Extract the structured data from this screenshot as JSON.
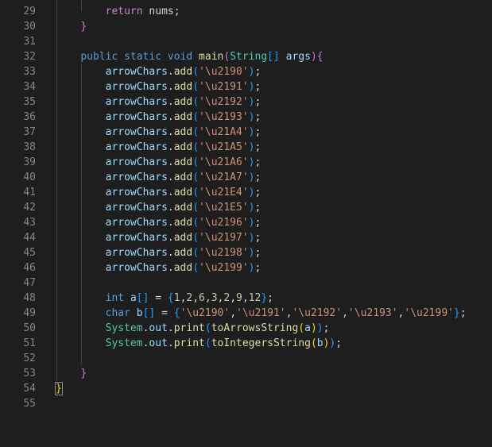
{
  "editor": {
    "lines": [
      {
        "n": "29",
        "tokens": [
          {
            "t": "        ",
            "c": "plain"
          },
          {
            "t": "return",
            "c": "kw-ctrl"
          },
          {
            "t": " nums;",
            "c": "plain"
          }
        ]
      },
      {
        "n": "30",
        "tokens": [
          {
            "t": "    ",
            "c": "plain"
          },
          {
            "t": "}",
            "c": "brace-purple"
          }
        ]
      },
      {
        "n": "31",
        "tokens": []
      },
      {
        "n": "32",
        "tokens": [
          {
            "t": "    ",
            "c": "plain"
          },
          {
            "t": "public",
            "c": "kw"
          },
          {
            "t": " ",
            "c": "plain"
          },
          {
            "t": "static",
            "c": "kw"
          },
          {
            "t": " ",
            "c": "plain"
          },
          {
            "t": "void",
            "c": "kw"
          },
          {
            "t": " ",
            "c": "plain"
          },
          {
            "t": "main",
            "c": "fn"
          },
          {
            "t": "(",
            "c": "brace-purple"
          },
          {
            "t": "String",
            "c": "type"
          },
          {
            "t": "[]",
            "c": "brace-blue"
          },
          {
            "t": " ",
            "c": "plain"
          },
          {
            "t": "args",
            "c": "var"
          },
          {
            "t": ")",
            "c": "brace-purple"
          },
          {
            "t": "{",
            "c": "brace-purple"
          }
        ]
      },
      {
        "n": "33",
        "tokens": [
          {
            "t": "        ",
            "c": "plain"
          },
          {
            "t": "arrowChars",
            "c": "var"
          },
          {
            "t": ".",
            "c": "plain"
          },
          {
            "t": "add",
            "c": "fn"
          },
          {
            "t": "(",
            "c": "brace-blue"
          },
          {
            "t": "'\\u2190'",
            "c": "str"
          },
          {
            "t": ")",
            "c": "brace-blue"
          },
          {
            "t": ";",
            "c": "plain"
          }
        ]
      },
      {
        "n": "34",
        "tokens": [
          {
            "t": "        ",
            "c": "plain"
          },
          {
            "t": "arrowChars",
            "c": "var"
          },
          {
            "t": ".",
            "c": "plain"
          },
          {
            "t": "add",
            "c": "fn"
          },
          {
            "t": "(",
            "c": "brace-blue"
          },
          {
            "t": "'\\u2191'",
            "c": "str"
          },
          {
            "t": ")",
            "c": "brace-blue"
          },
          {
            "t": ";",
            "c": "plain"
          }
        ]
      },
      {
        "n": "35",
        "tokens": [
          {
            "t": "        ",
            "c": "plain"
          },
          {
            "t": "arrowChars",
            "c": "var"
          },
          {
            "t": ".",
            "c": "plain"
          },
          {
            "t": "add",
            "c": "fn"
          },
          {
            "t": "(",
            "c": "brace-blue"
          },
          {
            "t": "'\\u2192'",
            "c": "str"
          },
          {
            "t": ")",
            "c": "brace-blue"
          },
          {
            "t": ";",
            "c": "plain"
          }
        ]
      },
      {
        "n": "36",
        "tokens": [
          {
            "t": "        ",
            "c": "plain"
          },
          {
            "t": "arrowChars",
            "c": "var"
          },
          {
            "t": ".",
            "c": "plain"
          },
          {
            "t": "add",
            "c": "fn"
          },
          {
            "t": "(",
            "c": "brace-blue"
          },
          {
            "t": "'\\u2193'",
            "c": "str"
          },
          {
            "t": ")",
            "c": "brace-blue"
          },
          {
            "t": ";",
            "c": "plain"
          }
        ]
      },
      {
        "n": "37",
        "tokens": [
          {
            "t": "        ",
            "c": "plain"
          },
          {
            "t": "arrowChars",
            "c": "var"
          },
          {
            "t": ".",
            "c": "plain"
          },
          {
            "t": "add",
            "c": "fn"
          },
          {
            "t": "(",
            "c": "brace-blue"
          },
          {
            "t": "'\\u21A4'",
            "c": "str"
          },
          {
            "t": ")",
            "c": "brace-blue"
          },
          {
            "t": ";",
            "c": "plain"
          }
        ]
      },
      {
        "n": "38",
        "tokens": [
          {
            "t": "        ",
            "c": "plain"
          },
          {
            "t": "arrowChars",
            "c": "var"
          },
          {
            "t": ".",
            "c": "plain"
          },
          {
            "t": "add",
            "c": "fn"
          },
          {
            "t": "(",
            "c": "brace-blue"
          },
          {
            "t": "'\\u21A5'",
            "c": "str"
          },
          {
            "t": ")",
            "c": "brace-blue"
          },
          {
            "t": ";",
            "c": "plain"
          }
        ]
      },
      {
        "n": "39",
        "tokens": [
          {
            "t": "        ",
            "c": "plain"
          },
          {
            "t": "arrowChars",
            "c": "var"
          },
          {
            "t": ".",
            "c": "plain"
          },
          {
            "t": "add",
            "c": "fn"
          },
          {
            "t": "(",
            "c": "brace-blue"
          },
          {
            "t": "'\\u21A6'",
            "c": "str"
          },
          {
            "t": ")",
            "c": "brace-blue"
          },
          {
            "t": ";",
            "c": "plain"
          }
        ]
      },
      {
        "n": "40",
        "tokens": [
          {
            "t": "        ",
            "c": "plain"
          },
          {
            "t": "arrowChars",
            "c": "var"
          },
          {
            "t": ".",
            "c": "plain"
          },
          {
            "t": "add",
            "c": "fn"
          },
          {
            "t": "(",
            "c": "brace-blue"
          },
          {
            "t": "'\\u21A7'",
            "c": "str"
          },
          {
            "t": ")",
            "c": "brace-blue"
          },
          {
            "t": ";",
            "c": "plain"
          }
        ]
      },
      {
        "n": "41",
        "tokens": [
          {
            "t": "        ",
            "c": "plain"
          },
          {
            "t": "arrowChars",
            "c": "var"
          },
          {
            "t": ".",
            "c": "plain"
          },
          {
            "t": "add",
            "c": "fn"
          },
          {
            "t": "(",
            "c": "brace-blue"
          },
          {
            "t": "'\\u21E4'",
            "c": "str"
          },
          {
            "t": ")",
            "c": "brace-blue"
          },
          {
            "t": ";",
            "c": "plain"
          }
        ]
      },
      {
        "n": "42",
        "tokens": [
          {
            "t": "        ",
            "c": "plain"
          },
          {
            "t": "arrowChars",
            "c": "var"
          },
          {
            "t": ".",
            "c": "plain"
          },
          {
            "t": "add",
            "c": "fn"
          },
          {
            "t": "(",
            "c": "brace-blue"
          },
          {
            "t": "'\\u21E5'",
            "c": "str"
          },
          {
            "t": ")",
            "c": "brace-blue"
          },
          {
            "t": ";",
            "c": "plain"
          }
        ]
      },
      {
        "n": "43",
        "tokens": [
          {
            "t": "        ",
            "c": "plain"
          },
          {
            "t": "arrowChars",
            "c": "var"
          },
          {
            "t": ".",
            "c": "plain"
          },
          {
            "t": "add",
            "c": "fn"
          },
          {
            "t": "(",
            "c": "brace-blue"
          },
          {
            "t": "'\\u2196'",
            "c": "str"
          },
          {
            "t": ")",
            "c": "brace-blue"
          },
          {
            "t": ";",
            "c": "plain"
          }
        ]
      },
      {
        "n": "44",
        "tokens": [
          {
            "t": "        ",
            "c": "plain"
          },
          {
            "t": "arrowChars",
            "c": "var"
          },
          {
            "t": ".",
            "c": "plain"
          },
          {
            "t": "add",
            "c": "fn"
          },
          {
            "t": "(",
            "c": "brace-blue"
          },
          {
            "t": "'\\u2197'",
            "c": "str"
          },
          {
            "t": ")",
            "c": "brace-blue"
          },
          {
            "t": ";",
            "c": "plain"
          }
        ]
      },
      {
        "n": "45",
        "tokens": [
          {
            "t": "        ",
            "c": "plain"
          },
          {
            "t": "arrowChars",
            "c": "var"
          },
          {
            "t": ".",
            "c": "plain"
          },
          {
            "t": "add",
            "c": "fn"
          },
          {
            "t": "(",
            "c": "brace-blue"
          },
          {
            "t": "'\\u2198'",
            "c": "str"
          },
          {
            "t": ")",
            "c": "brace-blue"
          },
          {
            "t": ";",
            "c": "plain"
          }
        ]
      },
      {
        "n": "46",
        "tokens": [
          {
            "t": "        ",
            "c": "plain"
          },
          {
            "t": "arrowChars",
            "c": "var"
          },
          {
            "t": ".",
            "c": "plain"
          },
          {
            "t": "add",
            "c": "fn"
          },
          {
            "t": "(",
            "c": "brace-blue"
          },
          {
            "t": "'\\u2199'",
            "c": "str"
          },
          {
            "t": ")",
            "c": "brace-blue"
          },
          {
            "t": ";",
            "c": "plain"
          }
        ]
      },
      {
        "n": "47",
        "tokens": []
      },
      {
        "n": "48",
        "tokens": [
          {
            "t": "        ",
            "c": "plain"
          },
          {
            "t": "int",
            "c": "kw"
          },
          {
            "t": " ",
            "c": "plain"
          },
          {
            "t": "a",
            "c": "var"
          },
          {
            "t": "[]",
            "c": "brace-blue"
          },
          {
            "t": " = ",
            "c": "plain"
          },
          {
            "t": "{",
            "c": "brace-blue"
          },
          {
            "t": "1",
            "c": "num"
          },
          {
            "t": ",",
            "c": "plain"
          },
          {
            "t": "2",
            "c": "num"
          },
          {
            "t": ",",
            "c": "plain"
          },
          {
            "t": "6",
            "c": "num"
          },
          {
            "t": ",",
            "c": "plain"
          },
          {
            "t": "3",
            "c": "num"
          },
          {
            "t": ",",
            "c": "plain"
          },
          {
            "t": "2",
            "c": "num"
          },
          {
            "t": ",",
            "c": "plain"
          },
          {
            "t": "9",
            "c": "num"
          },
          {
            "t": ",",
            "c": "plain"
          },
          {
            "t": "12",
            "c": "num"
          },
          {
            "t": "}",
            "c": "brace-blue"
          },
          {
            "t": ";",
            "c": "plain"
          }
        ]
      },
      {
        "n": "49",
        "tokens": [
          {
            "t": "        ",
            "c": "plain"
          },
          {
            "t": "char",
            "c": "kw"
          },
          {
            "t": " ",
            "c": "plain"
          },
          {
            "t": "b",
            "c": "var"
          },
          {
            "t": "[]",
            "c": "brace-blue"
          },
          {
            "t": " = ",
            "c": "plain"
          },
          {
            "t": "{",
            "c": "brace-blue"
          },
          {
            "t": "'\\u2190'",
            "c": "str"
          },
          {
            "t": ",",
            "c": "plain"
          },
          {
            "t": "'\\u2191'",
            "c": "str"
          },
          {
            "t": ",",
            "c": "plain"
          },
          {
            "t": "'\\u2192'",
            "c": "str"
          },
          {
            "t": ",",
            "c": "plain"
          },
          {
            "t": "'\\u2193'",
            "c": "str"
          },
          {
            "t": ",",
            "c": "plain"
          },
          {
            "t": "'\\u2199'",
            "c": "str"
          },
          {
            "t": "}",
            "c": "brace-blue"
          },
          {
            "t": ";",
            "c": "plain"
          }
        ]
      },
      {
        "n": "50",
        "tokens": [
          {
            "t": "        ",
            "c": "plain"
          },
          {
            "t": "System",
            "c": "type"
          },
          {
            "t": ".",
            "c": "plain"
          },
          {
            "t": "out",
            "c": "var"
          },
          {
            "t": ".",
            "c": "plain"
          },
          {
            "t": "print",
            "c": "fn"
          },
          {
            "t": "(",
            "c": "brace-blue"
          },
          {
            "t": "toArrowsString",
            "c": "fn"
          },
          {
            "t": "(",
            "c": "brace-yellow"
          },
          {
            "t": "a",
            "c": "var"
          },
          {
            "t": ")",
            "c": "brace-yellow"
          },
          {
            "t": ")",
            "c": "brace-blue"
          },
          {
            "t": ";",
            "c": "plain"
          }
        ]
      },
      {
        "n": "51",
        "tokens": [
          {
            "t": "        ",
            "c": "plain"
          },
          {
            "t": "System",
            "c": "type"
          },
          {
            "t": ".",
            "c": "plain"
          },
          {
            "t": "out",
            "c": "var"
          },
          {
            "t": ".",
            "c": "plain"
          },
          {
            "t": "print",
            "c": "fn"
          },
          {
            "t": "(",
            "c": "brace-blue"
          },
          {
            "t": "toIntegersString",
            "c": "fn"
          },
          {
            "t": "(",
            "c": "brace-yellow"
          },
          {
            "t": "b",
            "c": "var"
          },
          {
            "t": ")",
            "c": "brace-yellow"
          },
          {
            "t": ")",
            "c": "brace-blue"
          },
          {
            "t": ";",
            "c": "plain"
          }
        ]
      },
      {
        "n": "52",
        "tokens": []
      },
      {
        "n": "53",
        "tokens": [
          {
            "t": "    ",
            "c": "plain"
          },
          {
            "t": "}",
            "c": "brace-purple"
          }
        ]
      },
      {
        "n": "54",
        "tokens": [
          {
            "t": "}",
            "c": "brace-yellow",
            "match": true
          }
        ]
      },
      {
        "n": "55",
        "tokens": []
      }
    ]
  }
}
